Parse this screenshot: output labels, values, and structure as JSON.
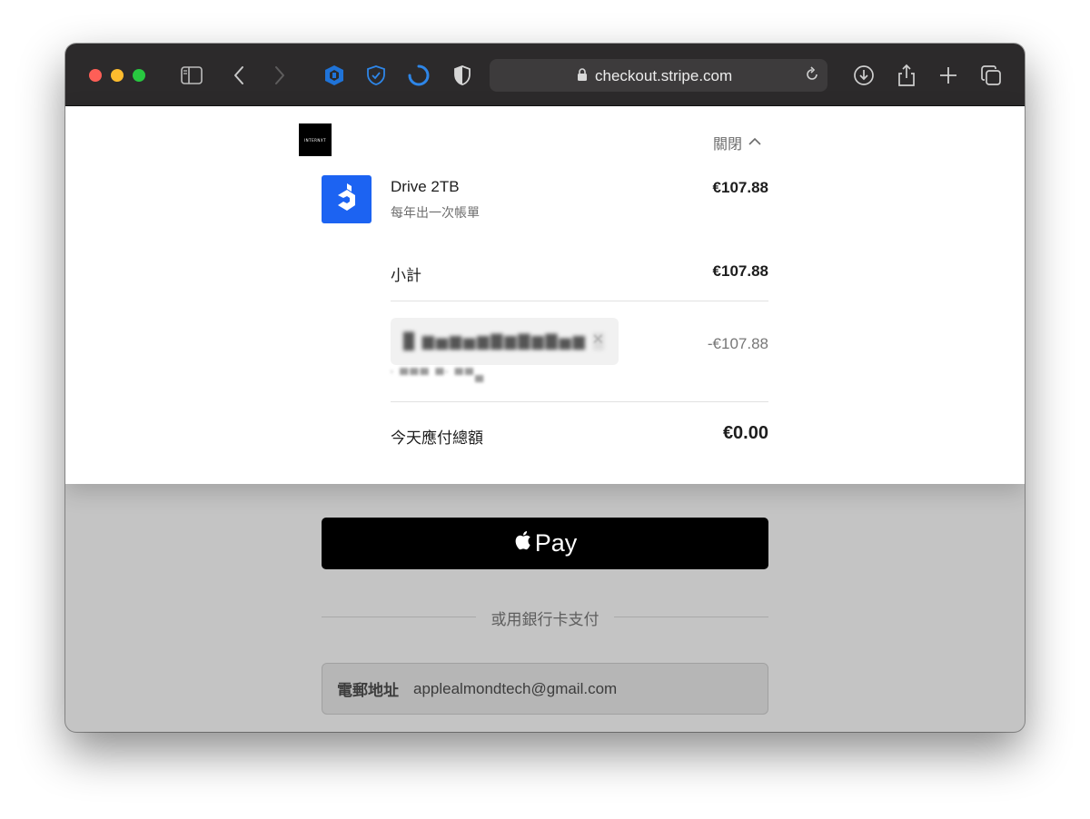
{
  "browser": {
    "url": "checkout.stripe.com",
    "icons": [
      "sidebar-icon",
      "back-icon",
      "forward-icon",
      "shield-extension-icon",
      "shield-check-icon",
      "loading-ring-icon",
      "half-shield-icon",
      "lock-icon",
      "reload-icon",
      "download-icon",
      "share-icon",
      "new-tab-icon",
      "tab-overview-icon"
    ]
  },
  "header": {
    "logo_text": "INTERNXT",
    "toggle_label": "關閉"
  },
  "product": {
    "name": "Drive 2TB",
    "billing": "每年出一次帳單",
    "price": "€107.88"
  },
  "subtotal": {
    "label": "小計",
    "value": "€107.88"
  },
  "promo": {
    "code": "█ ▆▅▆▅▆▇▆▇▆▇▅▆ ░",
    "description": "' ▀▀▀ ▀' ▀▀▄",
    "value": "-€107.88"
  },
  "total": {
    "label": "今天應付總額",
    "value": "€0.00"
  },
  "payment": {
    "apple_pay_label": "Pay",
    "divider_text": "或用銀行卡支付",
    "email_label": "電郵地址",
    "email_value": "applealmondtech@gmail.com"
  },
  "colors": {
    "toolbar": "#2c2a2b",
    "product_icon": "#1c63f2",
    "apple_pay": "#000000"
  }
}
